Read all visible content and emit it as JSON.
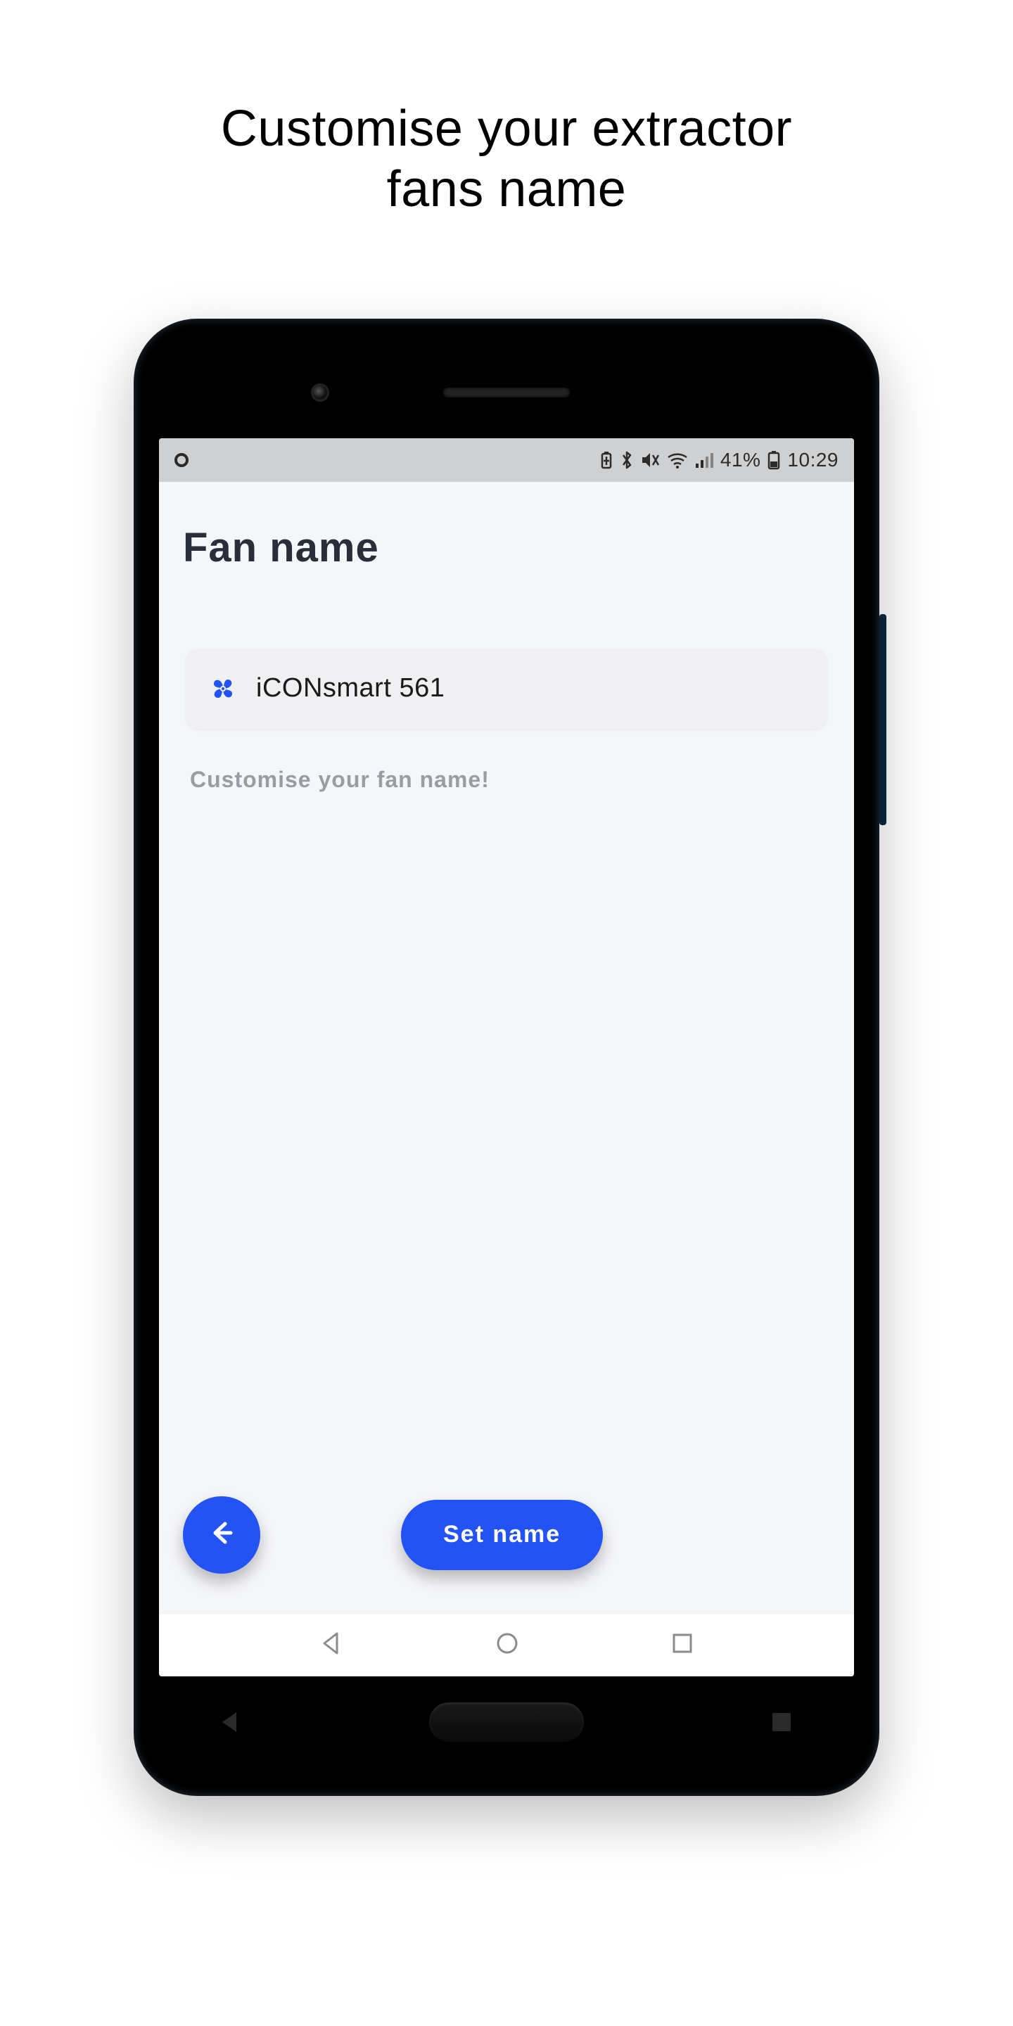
{
  "page": {
    "title_line1": "Customise your extractor",
    "title_line2": "fans name"
  },
  "status_bar": {
    "carrier_icon": "circle",
    "battery_percent": "41%",
    "time": "10:29"
  },
  "app": {
    "heading": "Fan name",
    "fan_name_value": "iCONsmart 561",
    "helper_text": "Customise your fan name!",
    "back_button_icon": "arrow-left",
    "set_button_label": "Set name"
  },
  "nav": {
    "back": "triangle",
    "home": "circle",
    "recent": "square"
  },
  "colors": {
    "accent": "#2453f5",
    "text_dark": "#2a2d3a",
    "text_muted": "#9a9ca3"
  }
}
